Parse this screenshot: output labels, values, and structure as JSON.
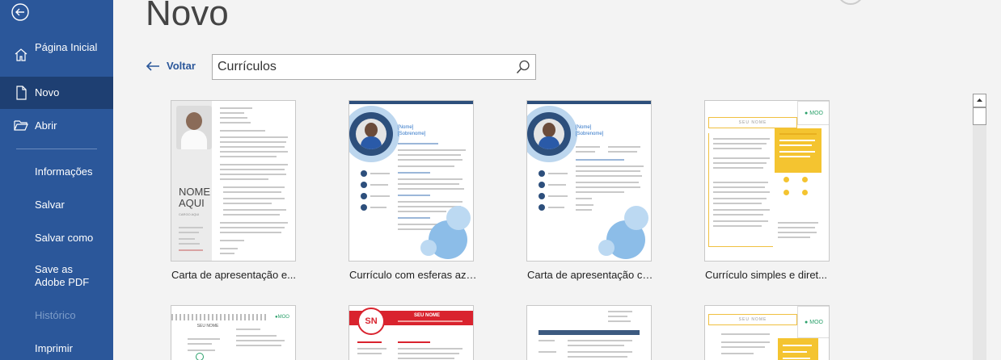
{
  "sidebar": {
    "items": [
      {
        "label": "Página Inicial",
        "icon": "home-icon"
      },
      {
        "label": "Novo",
        "icon": "new-document-icon"
      },
      {
        "label": "Abrir",
        "icon": "open-folder-icon"
      },
      {
        "label": "Informações"
      },
      {
        "label": "Salvar"
      },
      {
        "label": "Salvar como"
      },
      {
        "label": "Save as Adobe PDF"
      },
      {
        "label": "Histórico"
      },
      {
        "label": "Imprimir"
      }
    ],
    "active": "Novo",
    "disabled": "Histórico",
    "color": "#2b579a"
  },
  "page": {
    "title": "Novo",
    "back_label": "Voltar"
  },
  "search": {
    "value": "Currículos"
  },
  "templates": [
    {
      "label": "Carta de apresentação e...",
      "name_line1": "NOME",
      "name_line2": "AQUI",
      "subtitle": "CARGO AQUI"
    },
    {
      "label": "Currículo com esferas azuis",
      "name": "[Nome]",
      "surname": "[Sobrenome]"
    },
    {
      "label": "Carta de apresentação co...",
      "name": "[Nome]",
      "surname": "[Sobrenome]"
    },
    {
      "label": "Currículo simples e diret...",
      "header": "SEU NOME",
      "brand": "MOO"
    },
    {
      "header": "SEU NOME",
      "brand": "MOO"
    },
    {
      "initials": "SN",
      "header": "SEU NOME"
    },
    {},
    {
      "header": "SEU NOME",
      "brand": "MOO"
    }
  ]
}
